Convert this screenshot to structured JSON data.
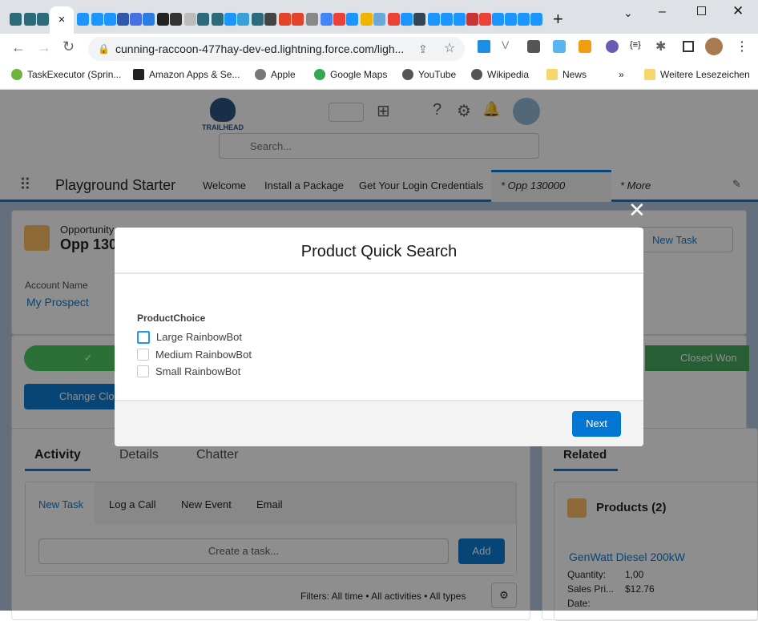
{
  "browser": {
    "active_tab_close": "×",
    "new_tab": "+",
    "url": "cunning-raccoon-477hay-dev-ed.lightning.force.com/ligh...",
    "bookmarks": [
      "TaskExecutor (Sprin...",
      "Amazon Apps & Se...",
      "Apple",
      "Google Maps",
      "YouTube",
      "Wikipedia",
      "News",
      "Weitere Lesezeichen"
    ],
    "bookmarks_more": "»"
  },
  "sf": {
    "logo": "TRAILHEAD",
    "search_placeholder": "Search...",
    "app_name": "Playground Starter",
    "nav": [
      "Welcome",
      "Install a Package",
      "Get Your Login Credentials",
      "* Opp 130000",
      "* More"
    ],
    "record_type": "Opportunity",
    "record_name": "Opp 130000",
    "new_task": "New Task",
    "account_label": "Account Name",
    "account_value": "My Prospect",
    "stage_closed": "Closed Won",
    "change_button": "Change Closed Stage",
    "tabs": [
      "Activity",
      "Details",
      "Chatter"
    ],
    "activity_tabs": [
      "New Task",
      "Log a Call",
      "New Event",
      "Email"
    ],
    "task_placeholder": "Create a task...",
    "add": "Add",
    "filters": "Filters: All time • All activities • All types",
    "related": "Related",
    "products": "Products (2)",
    "product_name": "GenWatt Diesel 200kW",
    "fields": [
      {
        "label": "Quantity:",
        "value": "1,00"
      },
      {
        "label": "Sales Pri...",
        "value": "$12.76"
      },
      {
        "label": "Date:",
        "value": ""
      }
    ]
  },
  "modal": {
    "title": "Product Quick Search",
    "group_label": "ProductChoice",
    "options": [
      {
        "label": "Large RainbowBot",
        "checked": false
      },
      {
        "label": "Medium RainbowBot",
        "checked": false
      },
      {
        "label": "Small RainbowBot",
        "checked": false
      }
    ],
    "next": "Next",
    "close": "✕"
  }
}
